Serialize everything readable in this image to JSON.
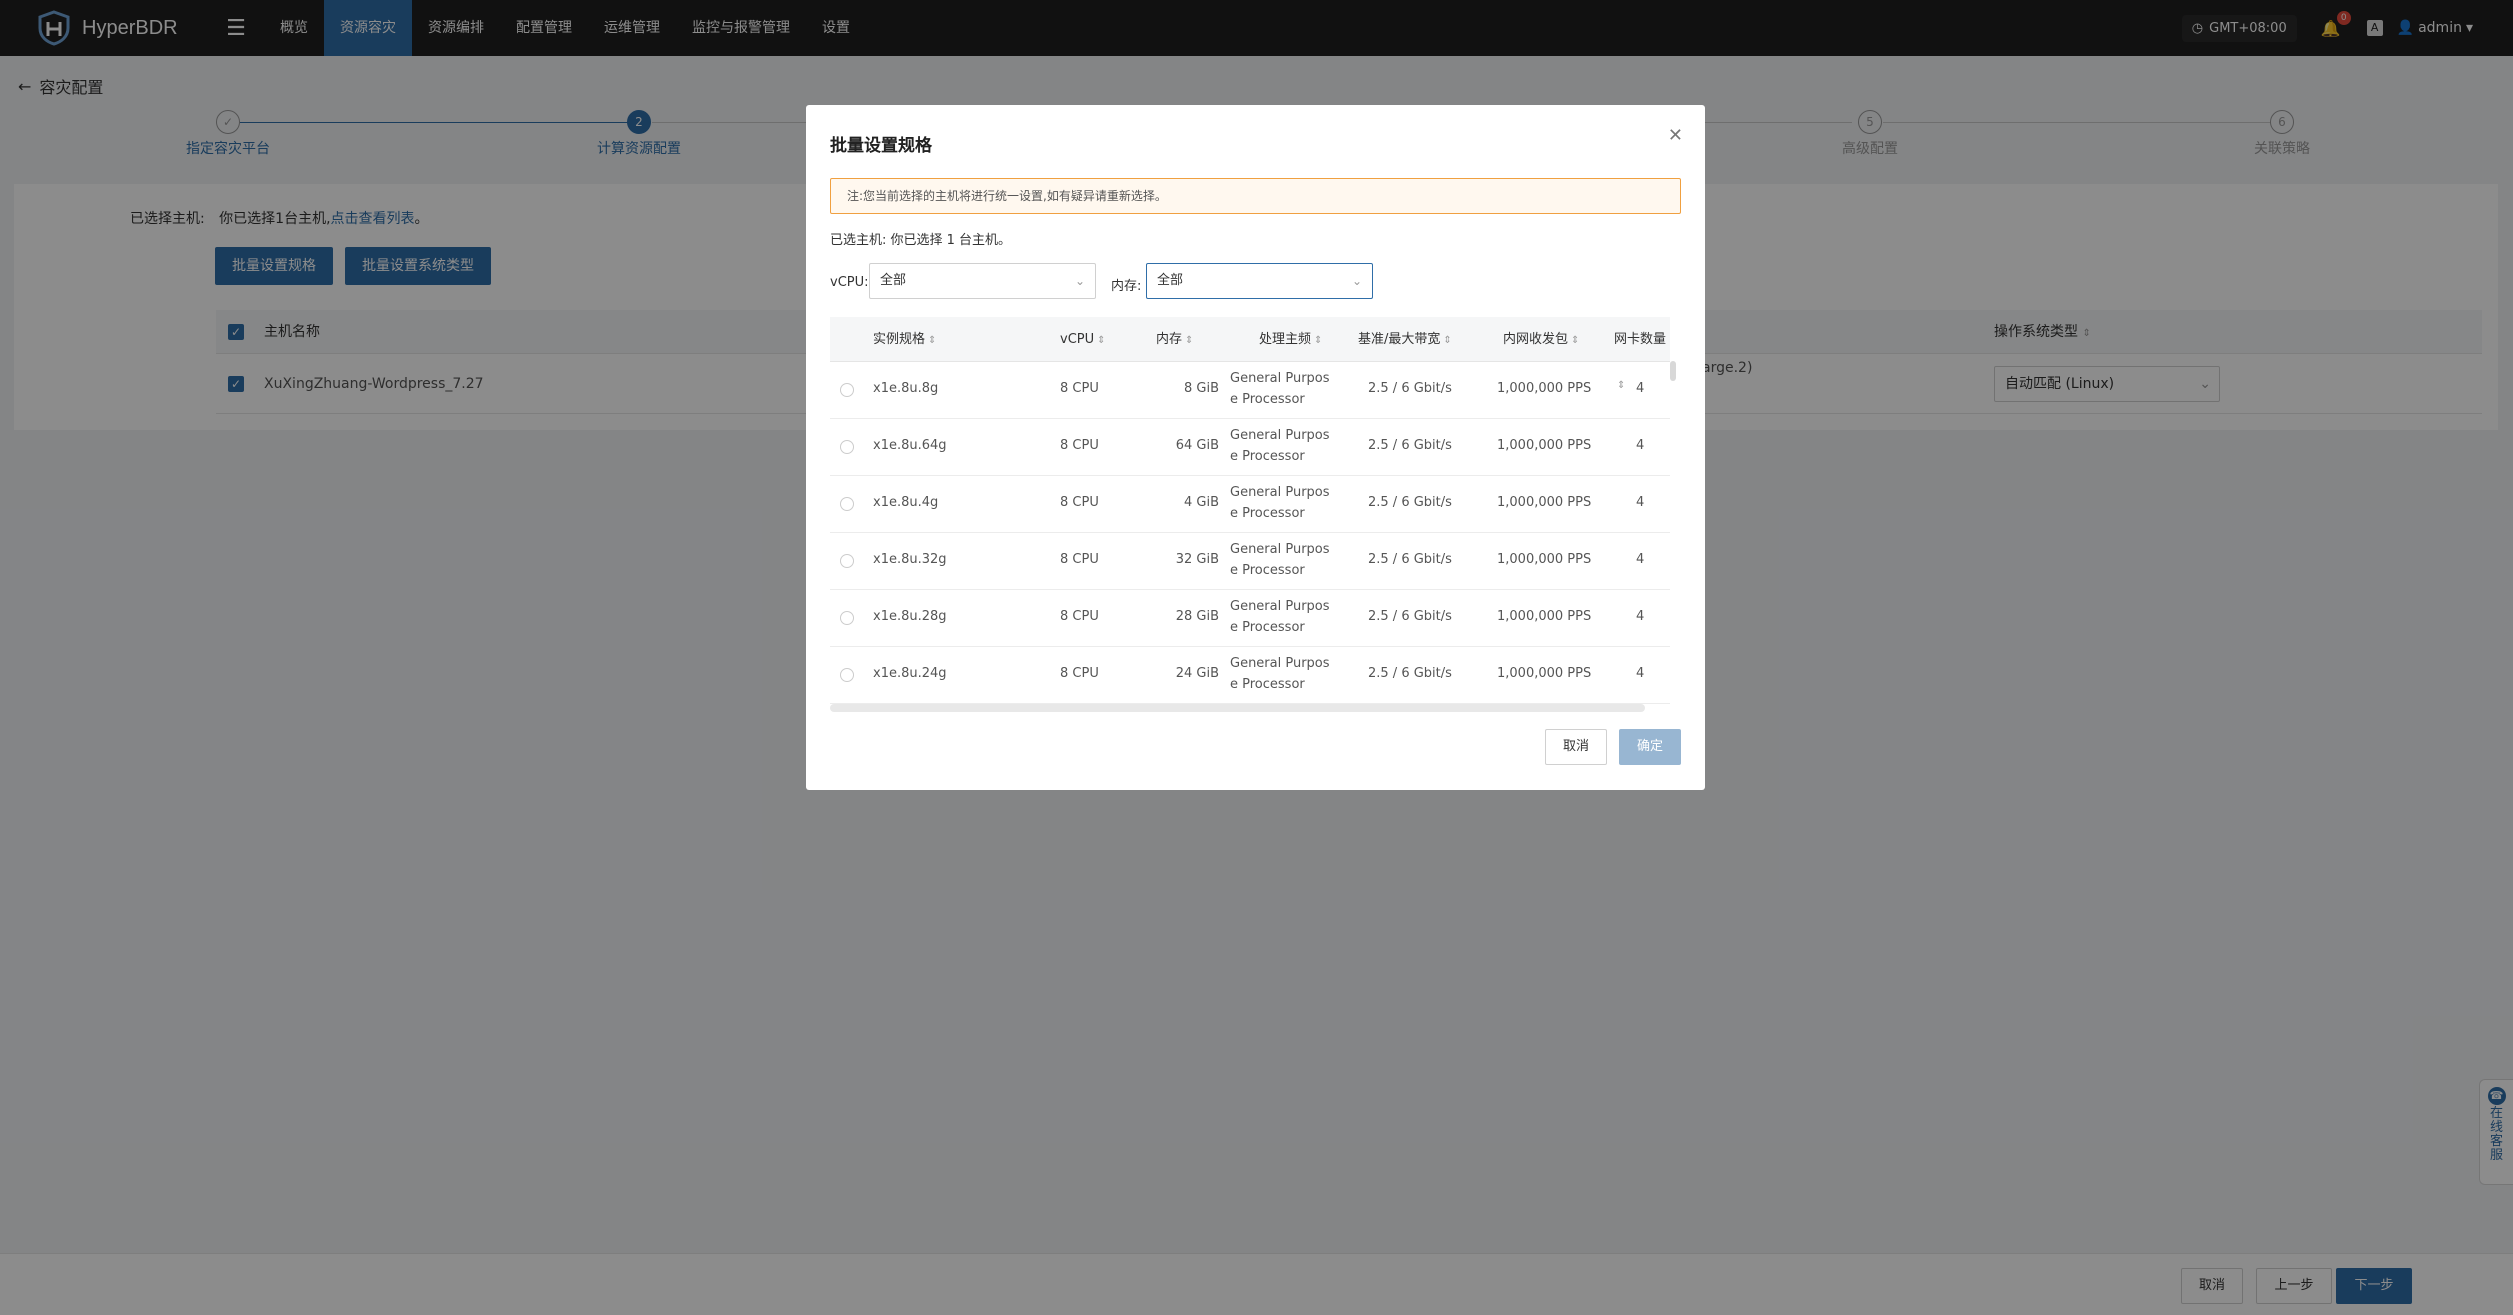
{
  "app": {
    "name": "HyperBDR"
  },
  "nav": {
    "items": [
      {
        "label": "概览",
        "active": false
      },
      {
        "label": "资源容灾",
        "active": true
      },
      {
        "label": "资源编排",
        "active": false
      },
      {
        "label": "配置管理",
        "active": false
      },
      {
        "label": "运维管理",
        "active": false
      },
      {
        "label": "监控与报警管理",
        "active": false
      },
      {
        "label": "设置",
        "active": false
      }
    ],
    "timezone": "GMT+08:00",
    "notification_count": "0",
    "user": "admin"
  },
  "page": {
    "back_title": "容灾配置",
    "steps": [
      {
        "num": "✓",
        "label": "指定容灾平台",
        "state": "done"
      },
      {
        "num": "2",
        "label": "计算资源配置",
        "state": "active"
      },
      {
        "num": "5",
        "label": "高级配置",
        "state": "pending"
      },
      {
        "num": "6",
        "label": "关联策略",
        "state": "pending"
      }
    ],
    "selected_label": "已选择主机:",
    "selected_text": "你已选择1台主机,",
    "view_list_link": "点击查看列表",
    "period": "。",
    "batch_spec_btn": "批量设置规格",
    "batch_os_btn": "批量设置系统类型",
    "host_col_name": "主机名称",
    "os_col": "操作系统类型",
    "host_name": "XuXingZhuang-Wordpress_7.27",
    "partial_spec": "arge.2)",
    "os_value": "自动匹配 (Linux)"
  },
  "modal": {
    "title": "批量设置规格",
    "notice": "注:您当前选择的主机将进行统一设置,如有疑异请重新选择。",
    "selected_info": "已选主机: 你已选择 1 台主机。",
    "vcpu_label": "vCPU:",
    "vcpu_value": "全部",
    "mem_label": "内存:",
    "mem_value": "全部",
    "columns": [
      "实例规格",
      "vCPU",
      "内存",
      "处理主频",
      "基准/最大带宽",
      "内网收发包",
      "网卡数量"
    ],
    "rows": [
      {
        "spec": "x1e.8u.8g",
        "vcpu": "8 CPU",
        "mem": "8 GiB",
        "proc1": "General Purpos",
        "proc2": "e Processor",
        "bw": "2.5 / 6 Gbit/s",
        "pps": "1,000,000 PPS",
        "nic": "4"
      },
      {
        "spec": "x1e.8u.64g",
        "vcpu": "8 CPU",
        "mem": "64 GiB",
        "proc1": "General Purpos",
        "proc2": "e Processor",
        "bw": "2.5 / 6 Gbit/s",
        "pps": "1,000,000 PPS",
        "nic": "4"
      },
      {
        "spec": "x1e.8u.4g",
        "vcpu": "8 CPU",
        "mem": "4 GiB",
        "proc1": "General Purpos",
        "proc2": "e Processor",
        "bw": "2.5 / 6 Gbit/s",
        "pps": "1,000,000 PPS",
        "nic": "4"
      },
      {
        "spec": "x1e.8u.32g",
        "vcpu": "8 CPU",
        "mem": "32 GiB",
        "proc1": "General Purpos",
        "proc2": "e Processor",
        "bw": "2.5 / 6 Gbit/s",
        "pps": "1,000,000 PPS",
        "nic": "4"
      },
      {
        "spec": "x1e.8u.28g",
        "vcpu": "8 CPU",
        "mem": "28 GiB",
        "proc1": "General Purpos",
        "proc2": "e Processor",
        "bw": "2.5 / 6 Gbit/s",
        "pps": "1,000,000 PPS",
        "nic": "4"
      },
      {
        "spec": "x1e.8u.24g",
        "vcpu": "8 CPU",
        "mem": "24 GiB",
        "proc1": "General Purpos",
        "proc2": "e Processor",
        "bw": "2.5 / 6 Gbit/s",
        "pps": "1,000,000 PPS",
        "nic": "4"
      }
    ],
    "cancel": "取消",
    "confirm": "确定"
  },
  "footer": {
    "cancel": "取消",
    "prev": "上一步",
    "next": "下一步"
  },
  "service": {
    "text": "在线客服"
  },
  "colors": {
    "accent": "#2f6ea8",
    "nav_bg": "#1f1f1f",
    "notice_border": "#f0a040"
  }
}
